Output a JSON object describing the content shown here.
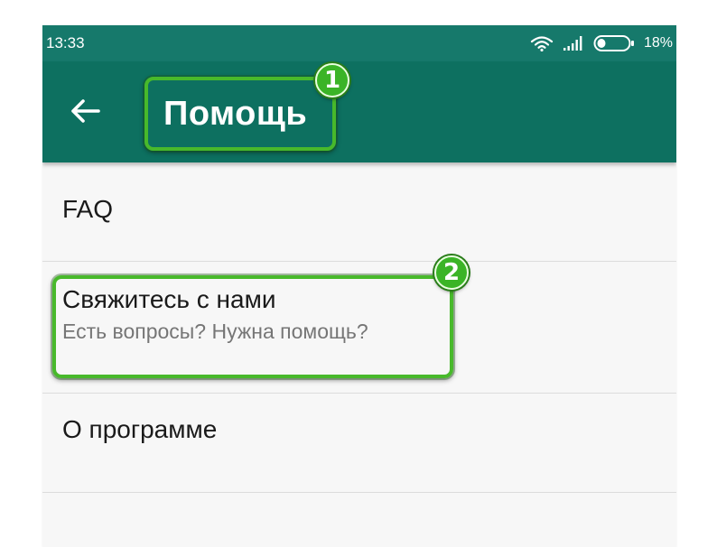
{
  "status_bar": {
    "time": "13:33",
    "battery_percent": "18%",
    "icons": [
      "wifi-icon",
      "signal-icon",
      "battery-icon"
    ]
  },
  "toolbar": {
    "back_icon": "arrow-left-icon",
    "title": "Помощь"
  },
  "menu": {
    "items": [
      {
        "title": "FAQ"
      },
      {
        "title": "Свяжитесь с нами",
        "subtitle": "Есть вопросы? Нужна помощь?"
      },
      {
        "title": "О программе"
      }
    ]
  },
  "annotations": {
    "badge_1": "1",
    "badge_2": "2"
  },
  "colors": {
    "status_bar": "#16796b",
    "toolbar": "#0d7060",
    "highlight": "#48b92b",
    "list_background": "#f7f7f7"
  }
}
